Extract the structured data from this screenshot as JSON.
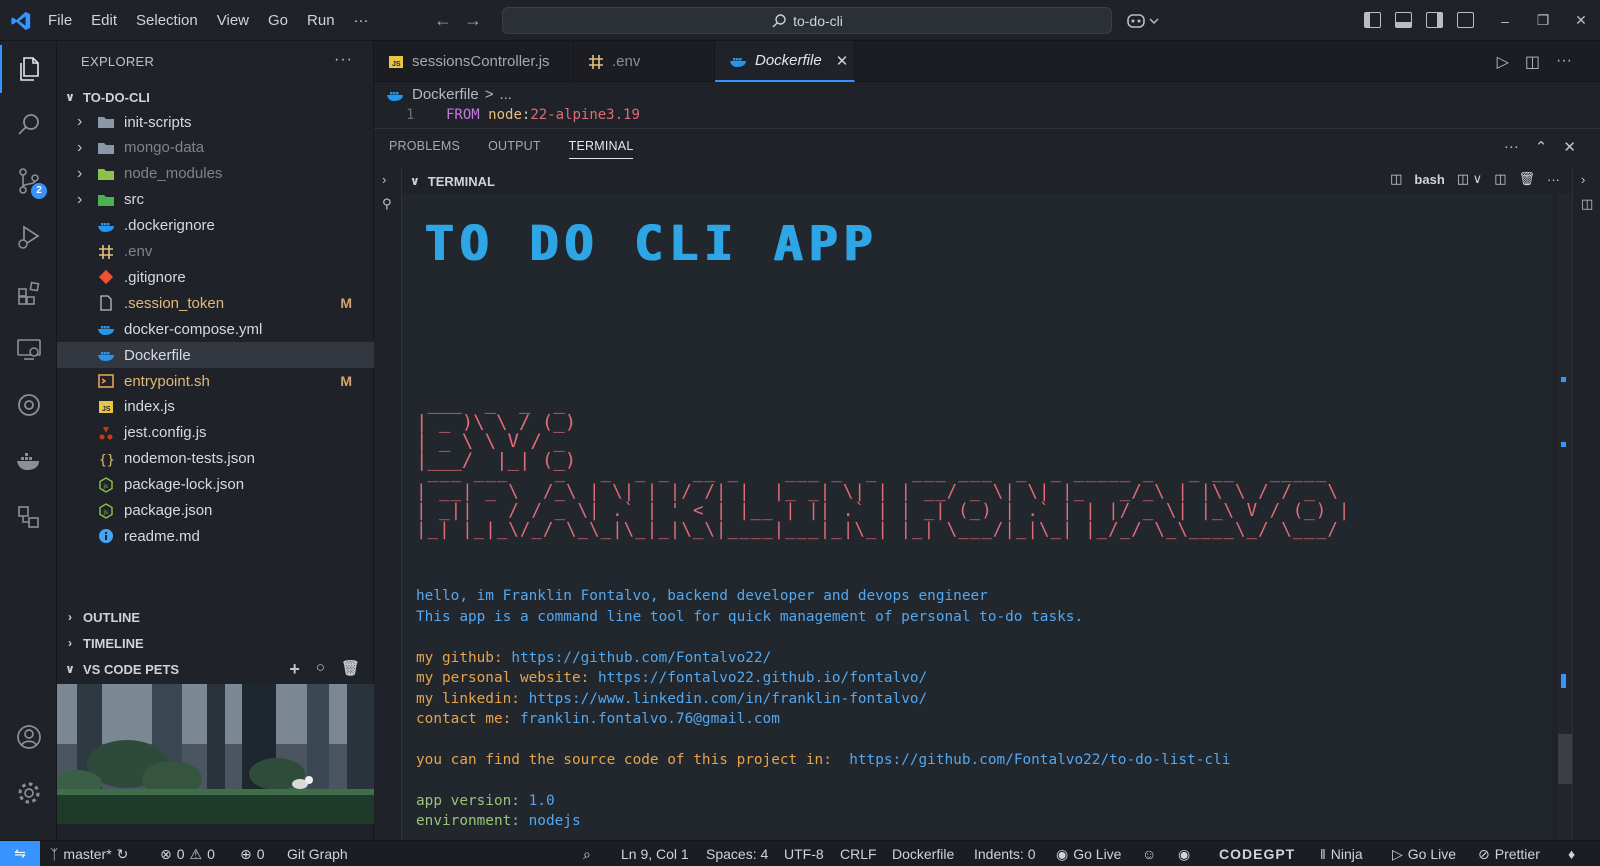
{
  "titlebar": {
    "menu": [
      "File",
      "Edit",
      "Selection",
      "View",
      "Go",
      "Run",
      "···"
    ],
    "search": "to-do-cli"
  },
  "activity": {
    "items": [
      "explorer-icon",
      "search-icon",
      "source-control-icon",
      "run-debug-icon",
      "extensions-icon",
      "remote-explorer-icon",
      "browser-icon",
      "docker-icon",
      "git-graph-icon"
    ],
    "scm_badge": "2",
    "bottom": [
      "account-icon",
      "settings-gear-icon"
    ]
  },
  "sidebar": {
    "title": "EXPLORER",
    "project": "TO-DO-CLI",
    "files": [
      {
        "name": "init-scripts",
        "type": "folder",
        "badge": ""
      },
      {
        "name": "mongo-data",
        "type": "folder",
        "badge": ""
      },
      {
        "name": "node_modules",
        "type": "folder",
        "badge": ""
      },
      {
        "name": "src",
        "type": "folder",
        "badge": ""
      },
      {
        "name": ".dockerignore",
        "type": "docker",
        "badge": ""
      },
      {
        "name": ".env",
        "type": "env",
        "badge": ""
      },
      {
        "name": ".gitignore",
        "type": "git",
        "badge": ""
      },
      {
        "name": ".session_token",
        "type": "file",
        "badge": "M"
      },
      {
        "name": "docker-compose.yml",
        "type": "docker",
        "badge": ""
      },
      {
        "name": "Dockerfile",
        "type": "docker",
        "badge": ""
      },
      {
        "name": "entrypoint.sh",
        "type": "shell",
        "badge": "M"
      },
      {
        "name": "index.js",
        "type": "js",
        "badge": ""
      },
      {
        "name": "jest.config.js",
        "type": "jest",
        "badge": ""
      },
      {
        "name": "nodemon-tests.json",
        "type": "json",
        "badge": ""
      },
      {
        "name": "package-lock.json",
        "type": "npm",
        "badge": ""
      },
      {
        "name": "package.json",
        "type": "npm",
        "badge": ""
      },
      {
        "name": "readme.md",
        "type": "info",
        "badge": ""
      }
    ],
    "sections": [
      "OUTLINE",
      "TIMELINE",
      "VS CODE PETS"
    ]
  },
  "tabs": [
    {
      "name": "sessionsController.js",
      "icon": "js-file-icon"
    },
    {
      "name": ".env",
      "icon": "env-file-icon"
    },
    {
      "name": "Dockerfile",
      "icon": "docker-file-icon"
    }
  ],
  "breadcrumb": {
    "file": "Dockerfile",
    "sep": "...",
    "chevron": ">"
  },
  "code": {
    "line": "1",
    "kw": "FROM",
    "img": "node",
    "colon": ":",
    "tag": "22-alpine3.19"
  },
  "panel": {
    "tabs": [
      "PROBLEMS",
      "OUTPUT",
      "TERMINAL"
    ],
    "terminal_label": "TERMINAL",
    "shell": "bash"
  },
  "terminal": {
    "banner": "TO DO CLI APP",
    "by_ascii": " ___  _  _  _\n| _ )\\ \\ / (_)\n| _ \\ \\ V / _\n|___/  |_| (_)",
    "name_ascii": " ___ ___    _   _  _ _  __ _    ___ _  _   ___ ___  _  _ _____ _   _ __   _____\n| __| _ \\  /_\\ | \\| | |/ /| |  |_ _| \\| | | __/ _ \\| \\| |_   _/_\\ | |\\ \\ / / _ \\\n| _||   / / _ \\| .` | ' < | |__ | || .` | | _| (_) | .` | | |/ _ \\| |_\\ V / (_) |\n|_| |_|_\\/_/ \\_\\_|\\_|_|\\_\\|____|___|_|\\_| |_| \\___/|_|\\_| |_/_/ \\_\\____\\_/ \\___/",
    "intro1": "hello, im Franklin Fontalvo, backend developer and devops engineer",
    "intro2": "This app is a command line tool for quick management of personal to-do tasks.",
    "github_label": "my github: ",
    "github_url": "https://github.com/Fontalvo22/",
    "website_label": "my personal website: ",
    "website_url": "https://fontalvo22.github.io/fontalvo/",
    "linkedin_label": "my linkedin: ",
    "linkedin_url": "https://www.linkedin.com/in/franklin-fontalvo/",
    "contact_label": "contact me: ",
    "contact_value": "franklin.fontalvo.76@gmail.com",
    "source_label": "you can find the source code of this project in:  ",
    "source_url": "https://github.com/Fontalvo22/to-do-list-cli",
    "version_label": "app version: ",
    "version_value": "1.0",
    "env_label": "environment: ",
    "env_value": "nodejs"
  },
  "statusbar": {
    "branch": "master*",
    "errors": "0",
    "warnings": "0",
    "ports": "0",
    "git_graph": "Git Graph",
    "position": "Ln 9, Col 1",
    "spaces": "Spaces: 4",
    "encoding": "UTF-8",
    "eol": "CRLF",
    "language": "Dockerfile",
    "indents": "Indents: 0",
    "golive1": "Go Live",
    "codegpt": "CODEGPT",
    "ninja": "Ninja",
    "golive2": "Go Live",
    "prettier": "Prettier"
  },
  "colors": {
    "accent": "#3794ff",
    "terminal_red": "#e06c75",
    "terminal_blue": "#52a8f0",
    "terminal_orange": "#e5a34e",
    "banner": "#2ea6e6"
  }
}
